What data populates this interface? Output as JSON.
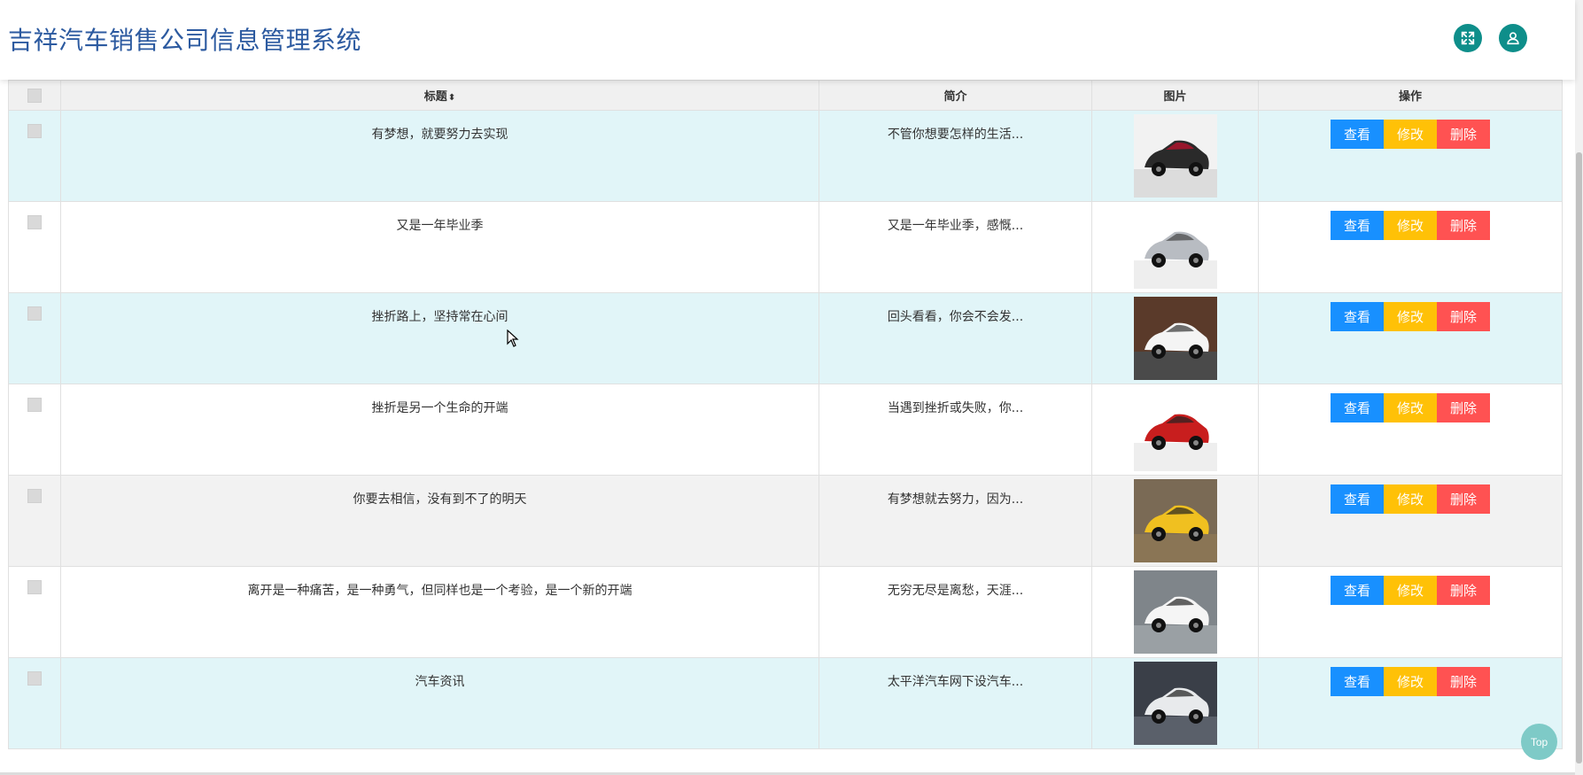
{
  "header": {
    "title": "吉祥汽车销售公司信息管理系统",
    "fullscreen_icon": "fullscreen-icon",
    "user_icon": "user-icon",
    "accent_color": "#0e8e8a"
  },
  "table": {
    "columns": [
      "",
      "标题",
      "简介",
      "图片",
      "操作"
    ],
    "sort_icon": "⬍",
    "actions": {
      "view": "查看",
      "edit": "修改",
      "delete": "删除"
    },
    "rows": [
      {
        "title": "有梦想，就要努力去实现",
        "summary": "不管你想要怎样的生活...",
        "image": "black-sports-car"
      },
      {
        "title": "又是一年毕业季",
        "summary": "又是一年毕业季，感慨...",
        "image": "silver-suv"
      },
      {
        "title": "挫折路上，坚持常在心间",
        "summary": "回头看看，你会不会发...",
        "image": "white-suv-street"
      },
      {
        "title": "挫折是另一个生命的开端",
        "summary": "当遇到挫折或失败，你...",
        "image": "red-sedan"
      },
      {
        "title": "你要去相信，没有到不了的明天",
        "summary": "有梦想就去努力，因为...",
        "image": "yellow-muscle-car"
      },
      {
        "title": "离开是一种痛苦，是一种勇气，但同样也是一个考验，是一个新的开端",
        "summary": "无穷无尽是离愁，天涯...",
        "image": "white-coupe"
      },
      {
        "title": "汽车资讯",
        "summary": "太平洋汽车网下设汽车...",
        "image": "white-bmw-suv"
      }
    ]
  },
  "top_button": {
    "label": "Top"
  }
}
